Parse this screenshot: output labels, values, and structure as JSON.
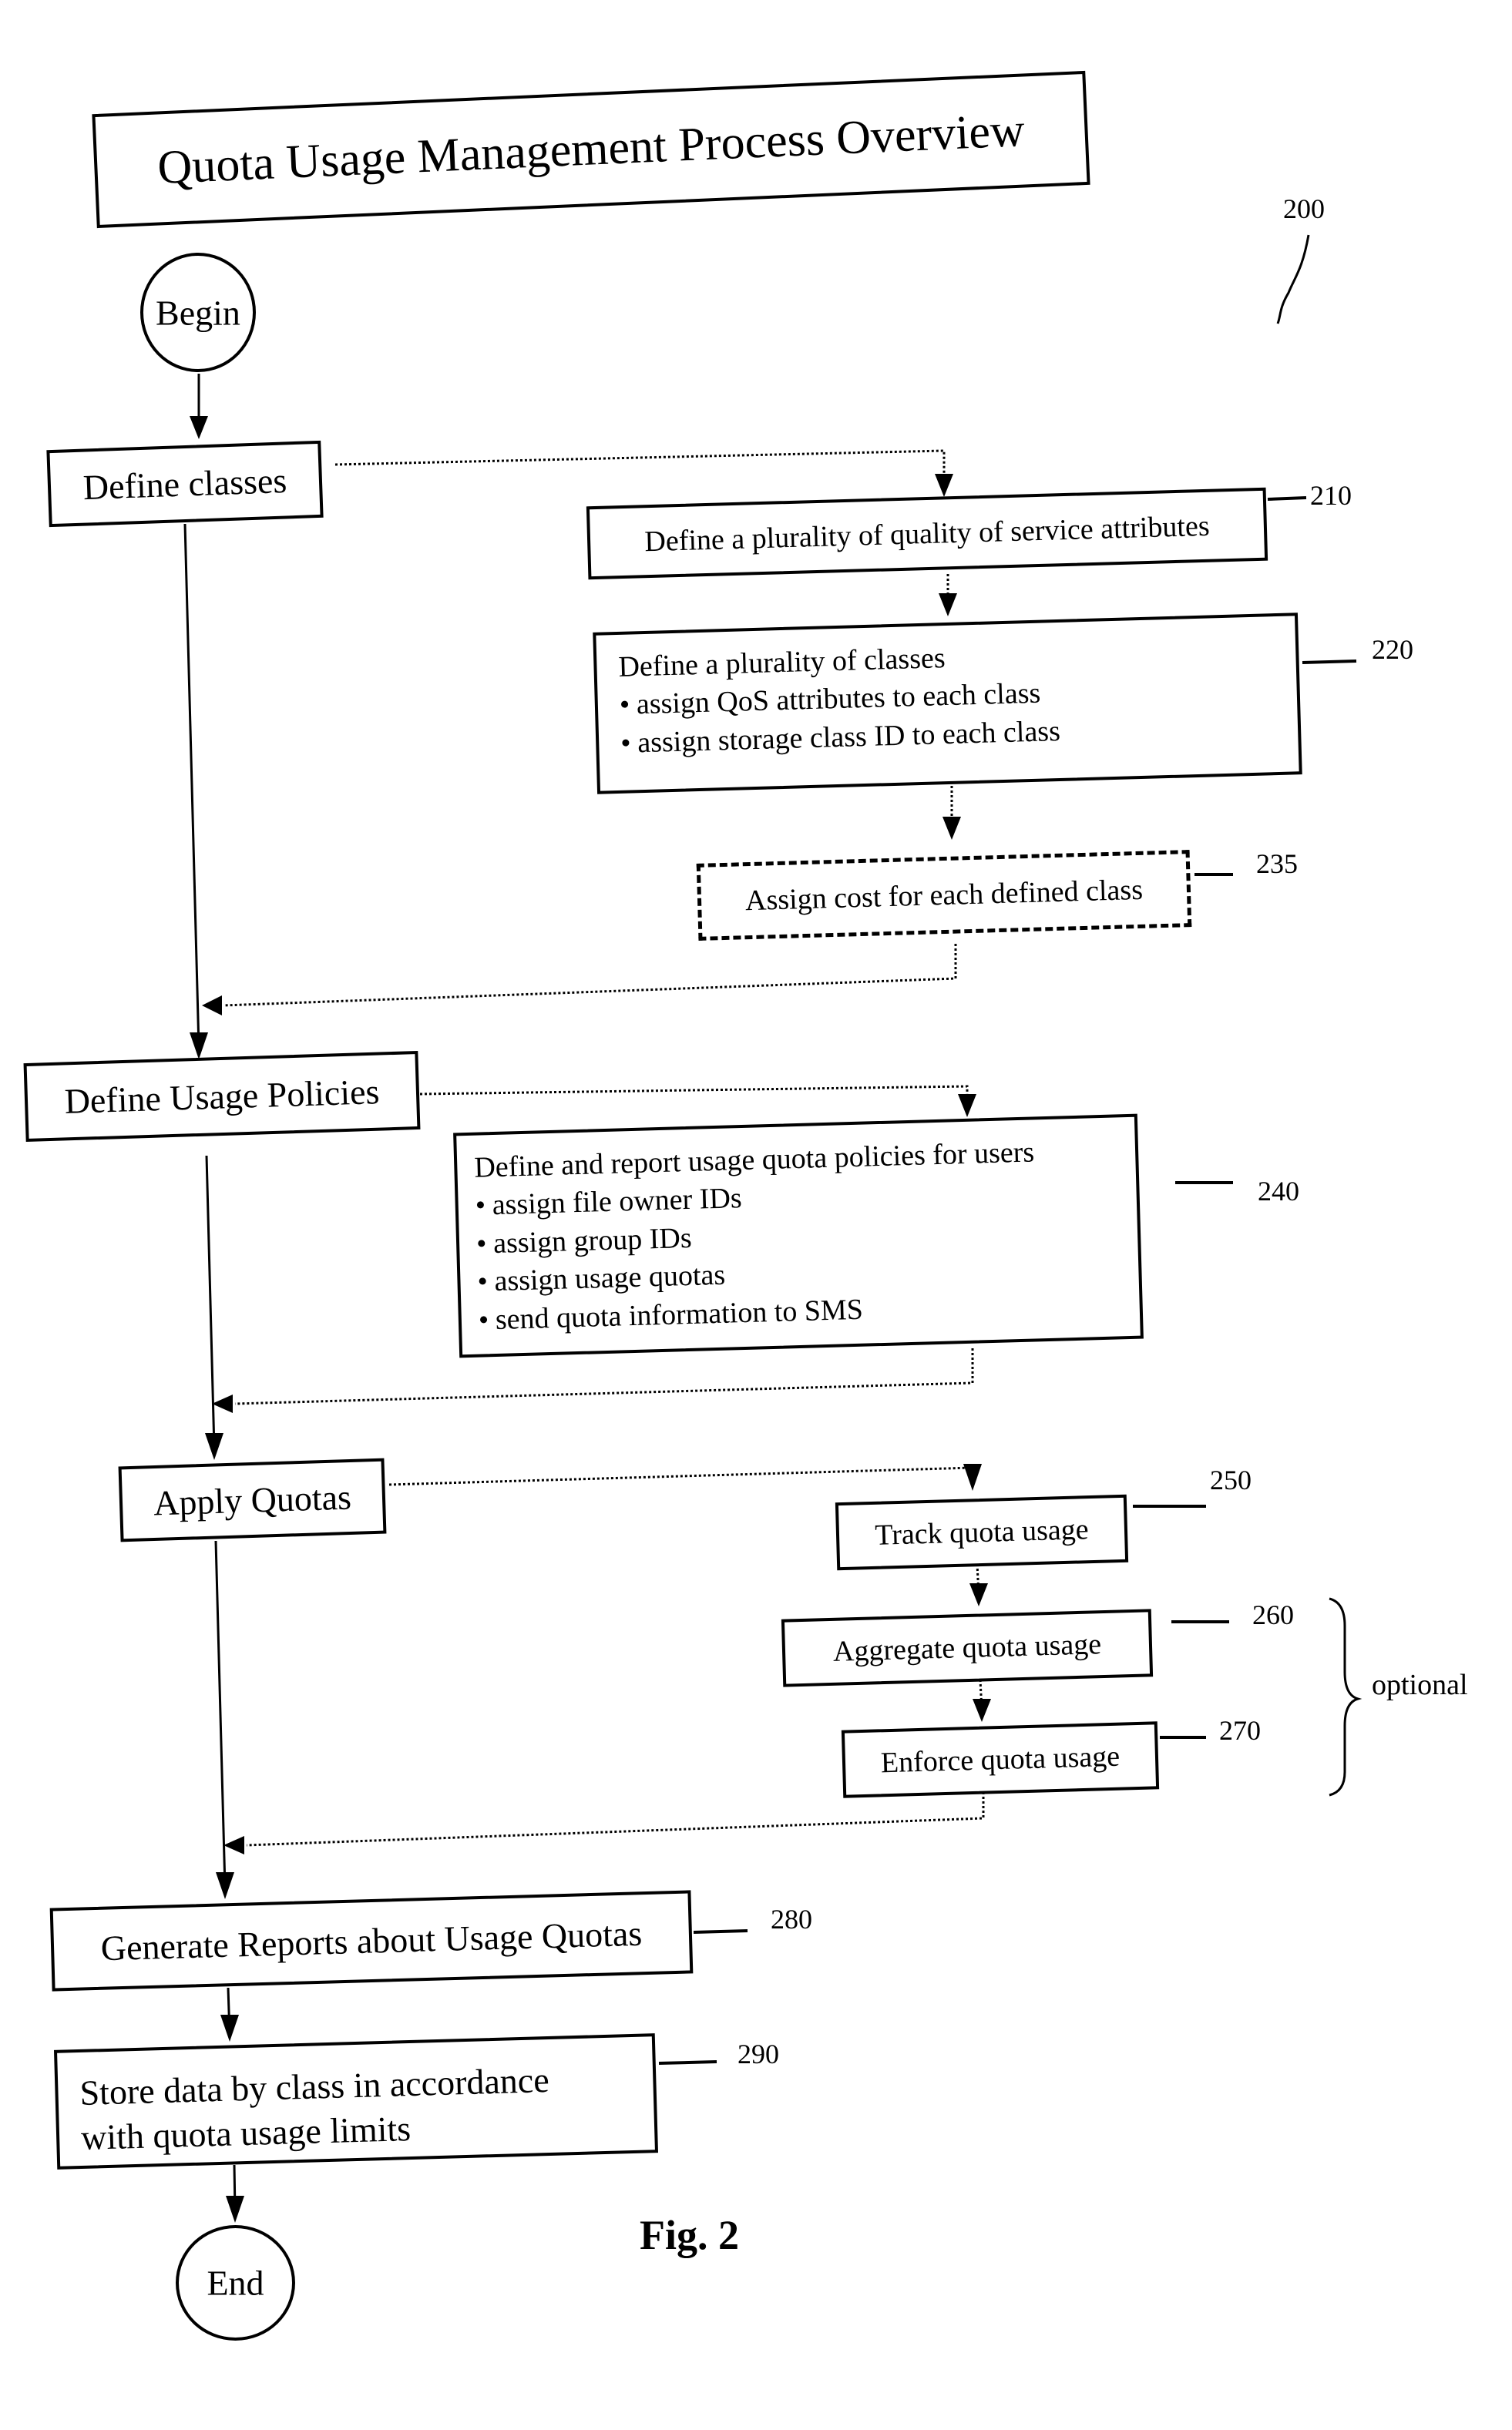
{
  "title": "Quota Usage Management Process Overview",
  "figure_ref": "200",
  "figure_caption": "Fig. 2",
  "begin_label": "Begin",
  "end_label": "End",
  "main_steps": {
    "define_classes": "Define classes",
    "define_usage_policies": "Define Usage Policies",
    "apply_quotas": "Apply Quotas",
    "generate_reports": "Generate Reports about Usage Quotas",
    "store_data_line1": "Store data by class in accordance",
    "store_data_line2": "with quota usage limits"
  },
  "sub_steps": {
    "qos_attributes": "Define a plurality of quality of service attributes",
    "classes_heading": "Define a plurality of classes",
    "classes_bullets": [
      "assign QoS attributes to each class",
      "assign storage class ID to each class"
    ],
    "assign_cost": "Assign cost for each defined class",
    "policies_heading": "Define and report usage quota policies for users",
    "policies_bullets": [
      "assign file owner IDs",
      "assign group IDs",
      "assign usage quotas",
      "send quota information to SMS"
    ],
    "track": "Track quota usage",
    "aggregate": "Aggregate quota usage",
    "enforce": "Enforce quota usage"
  },
  "refs": {
    "r210": "210",
    "r220": "220",
    "r235": "235",
    "r240": "240",
    "r250": "250",
    "r260": "260",
    "r270": "270",
    "r280": "280",
    "r290": "290"
  },
  "optional_label": "optional"
}
